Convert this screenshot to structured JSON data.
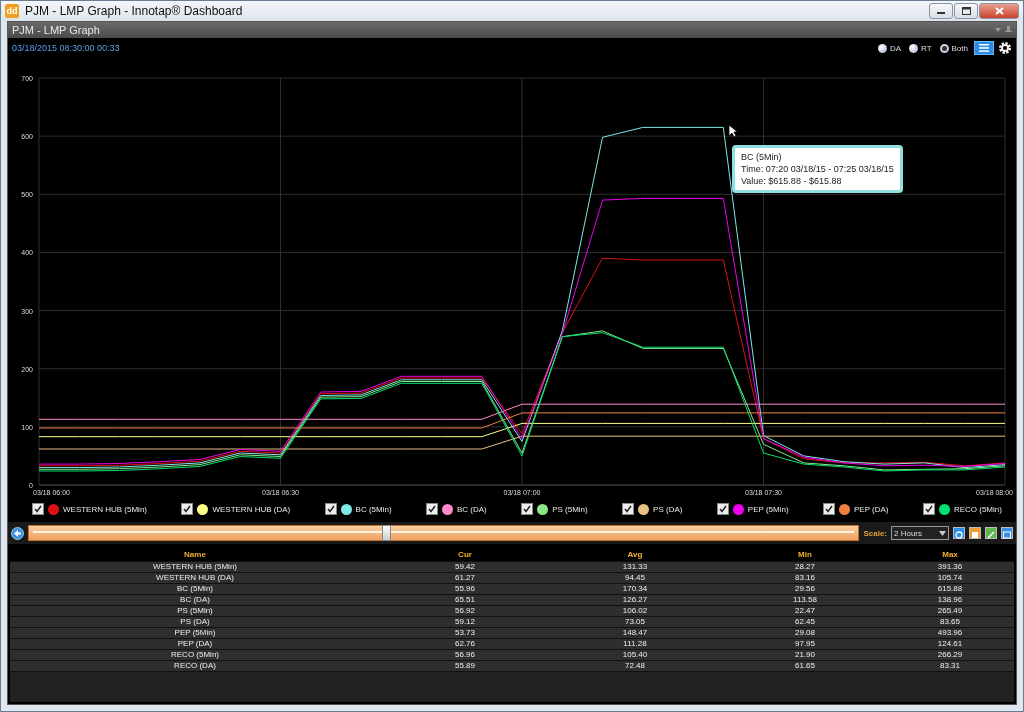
{
  "window": {
    "title": "PJM - LMP Graph - Innotap® Dashboard",
    "app_icon": "dd"
  },
  "panel": {
    "title": "PJM - LMP Graph"
  },
  "toolbar": {
    "timestamp": "03/18/2015 08:30:00  00:33",
    "modes": [
      {
        "label": "DA",
        "selected": false
      },
      {
        "label": "RT",
        "selected": false
      },
      {
        "label": "Both",
        "selected": true
      }
    ]
  },
  "chart": {
    "chart_data": {
      "type": "line",
      "categories": [
        "03/18 06:00",
        null,
        null,
        null,
        null,
        null,
        "03/18 06:30",
        null,
        null,
        null,
        null,
        null,
        "03/18 07:00",
        null,
        null,
        null,
        null,
        null,
        "03/18 07:30",
        null,
        null,
        null,
        null,
        null,
        "03/18 08:00"
      ],
      "ylim": [
        0,
        700
      ],
      "grid": true,
      "yticks": [
        0,
        100,
        200,
        300,
        400,
        500,
        600,
        700
      ],
      "series": [
        {
          "name": "WESTERN HUB (5Min)",
          "color": "#dd1111",
          "values": [
            33,
            33,
            34,
            37,
            41,
            58,
            55,
            157,
            158,
            184,
            184,
            184,
            88,
            262,
            390,
            387,
            387,
            387,
            80,
            45,
            38,
            38,
            39,
            33,
            38
          ]
        },
        {
          "name": "WESTERN HUB (DA)",
          "color": "#ffff88",
          "values": [
            83,
            83,
            83,
            83,
            83,
            83,
            83,
            83,
            83,
            83,
            83,
            83,
            106,
            106,
            106,
            106,
            106,
            106,
            106,
            106,
            106,
            106,
            106,
            106,
            106
          ]
        },
        {
          "name": "BC (5Min)",
          "color": "#80e8e8",
          "values": [
            30,
            30,
            31,
            34,
            38,
            55,
            52,
            154,
            155,
            181,
            181,
            181,
            75,
            265,
            598,
            615,
            615,
            615,
            85,
            50,
            40,
            36,
            38,
            30,
            35
          ]
        },
        {
          "name": "BC (DA)",
          "color": "#ff88c8",
          "values": [
            113,
            113,
            113,
            113,
            113,
            113,
            113,
            113,
            113,
            113,
            113,
            113,
            139,
            139,
            139,
            139,
            139,
            139,
            139,
            139,
            139,
            139,
            139,
            139,
            139
          ]
        },
        {
          "name": "PS (5Min)",
          "color": "#88e888",
          "values": [
            27,
            27,
            28,
            31,
            35,
            52,
            49,
            151,
            152,
            178,
            178,
            178,
            55,
            255,
            265,
            235,
            235,
            235,
            70,
            38,
            33,
            26,
            27,
            28,
            33
          ]
        },
        {
          "name": "PS (DA)",
          "color": "#e8c080",
          "values": [
            62,
            62,
            62,
            62,
            62,
            62,
            62,
            62,
            62,
            62,
            62,
            62,
            84,
            84,
            84,
            84,
            84,
            84,
            84,
            84,
            84,
            84,
            84,
            84,
            84
          ]
        },
        {
          "name": "PEP (5Min)",
          "color": "#ee00ee",
          "values": [
            36,
            36,
            37,
            40,
            44,
            61,
            58,
            160,
            161,
            187,
            187,
            187,
            80,
            260,
            490,
            493,
            493,
            493,
            80,
            48,
            38,
            33,
            34,
            32,
            37
          ]
        },
        {
          "name": "PEP (DA)",
          "color": "#f08040",
          "values": [
            98,
            98,
            98,
            98,
            98,
            98,
            98,
            98,
            98,
            98,
            98,
            98,
            124,
            124,
            124,
            124,
            124,
            124,
            124,
            124,
            124,
            124,
            124,
            124,
            124
          ]
        },
        {
          "name": "RECO (5Min)",
          "color": "#00e070",
          "values": [
            24,
            24,
            25,
            28,
            32,
            49,
            46,
            148,
            149,
            175,
            175,
            175,
            50,
            255,
            262,
            237,
            237,
            237,
            55,
            36,
            31,
            24,
            26,
            26,
            31
          ]
        }
      ]
    },
    "tooltip": {
      "title": "BC (5Min)",
      "lines": [
        "Time: 07:20 03/18/15 - 07:25 03/18/15",
        "Value: $615.88 - $615.88"
      ]
    }
  },
  "legend": [
    {
      "checked": true
    },
    {
      "checked": true
    },
    {
      "checked": true
    },
    {
      "checked": true
    },
    {
      "checked": true
    },
    {
      "checked": true
    },
    {
      "checked": true
    },
    {
      "checked": true
    },
    {
      "checked": true
    }
  ],
  "timeline": {
    "level": 0.43,
    "scale_label": "Scale:",
    "scale_value": "2 Hours"
  },
  "table": {
    "columns": [
      "Name",
      "Cur",
      "Avg",
      "Min",
      "Max"
    ],
    "rows": [
      [
        "WESTERN HUB (5Min)",
        "59.42",
        "131.33",
        "28.27",
        "391.36"
      ],
      [
        "WESTERN HUB (DA)",
        "61.27",
        "94.45",
        "83.16",
        "105.74"
      ],
      [
        "BC (5Min)",
        "55.96",
        "170.34",
        "29.56",
        "615.88"
      ],
      [
        "BC (DA)",
        "65.51",
        "126.27",
        "113.58",
        "138.96"
      ],
      [
        "PS (5Min)",
        "56.92",
        "106.02",
        "22.47",
        "265.49"
      ],
      [
        "PS (DA)",
        "59.12",
        "73.05",
        "62.45",
        "83.65"
      ],
      [
        "PEP (5Min)",
        "53.73",
        "148.47",
        "29.08",
        "493.96"
      ],
      [
        "PEP (DA)",
        "62.76",
        "111.28",
        "97.95",
        "124.61"
      ],
      [
        "RECO (5Min)",
        "56.96",
        "105.40",
        "21.90",
        "266.29"
      ],
      [
        "RECO (DA)",
        "55.89",
        "72.48",
        "61.65",
        "83.31"
      ]
    ]
  }
}
